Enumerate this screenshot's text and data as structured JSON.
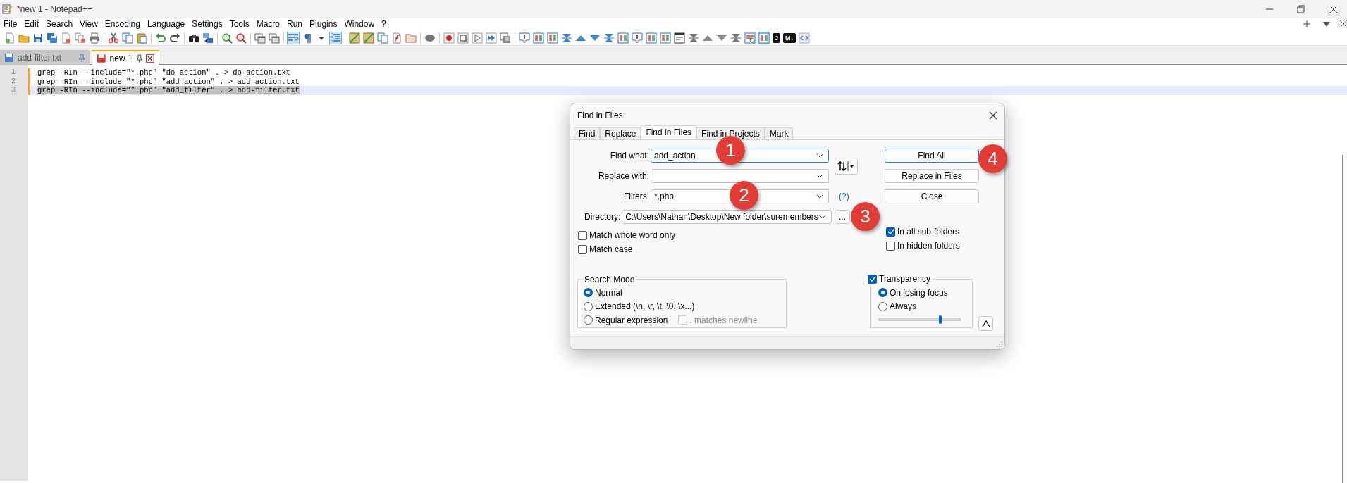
{
  "window": {
    "title": "*new 1 - Notepad++"
  },
  "menu": [
    "File",
    "Edit",
    "Search",
    "View",
    "Encoding",
    "Language",
    "Settings",
    "Tools",
    "Macro",
    "Run",
    "Plugins",
    "Window",
    "?"
  ],
  "toolbar_toggles": [
    {
      "pressed": true
    },
    {
      "pressed": false
    },
    {
      "pressed": true
    },
    {
      "pressed": true
    }
  ],
  "toolbar_badges": [
    "J",
    "M↓"
  ],
  "tabs": [
    {
      "label": "add-filter.txt",
      "selected": false
    },
    {
      "label": "new 1",
      "selected": true
    }
  ],
  "editor": {
    "lines": [
      {
        "number": "1",
        "text": "grep -RIn --include=\"*.php\" \"do_action\" . > do-action.txt",
        "selected": false
      },
      {
        "number": "2",
        "text": "grep -RIn --include=\"*.php\" \"add_action\" . > add-action.txt",
        "selected": false
      },
      {
        "number": "3",
        "text": "grep -RIn --include=\"*.php\" \"add_filter\" . > add-filter.txt",
        "selected": true
      }
    ]
  },
  "dialog": {
    "title": "Find in Files",
    "tabs": [
      {
        "label": "Find",
        "selected": false
      },
      {
        "label": "Replace",
        "selected": false
      },
      {
        "label": "Find in Files",
        "selected": true
      },
      {
        "label": "Find in Projects",
        "selected": false
      },
      {
        "label": "Mark",
        "selected": false
      }
    ],
    "fields": [
      {
        "kind": "combo",
        "label": "Find what:",
        "value": "add_action",
        "focused": true
      },
      {
        "kind": "combo",
        "label": "Replace with:",
        "focused": false
      },
      {
        "kind": "combo",
        "label": "Filters:",
        "value": "*.php",
        "focused": false,
        "help": "(?)"
      },
      {
        "kind": "folder",
        "label": "Directory:",
        "value": "C:\\Users\\Nathan\\Desktop\\New folder\\suremembers",
        "focused": false,
        "browse": "..."
      }
    ],
    "buttons": [
      {
        "label": "Find All",
        "default": true
      },
      {
        "label": "Replace in Files",
        "default": false
      },
      {
        "label": "Close",
        "default": false
      }
    ],
    "options": [
      {
        "label": "Match whole word only",
        "checked": false
      },
      {
        "label": "Match case",
        "checked": false
      }
    ],
    "folder_options": [
      {
        "label": "In all sub-folders",
        "checked": true
      },
      {
        "label": "In hidden folders",
        "checked": false
      }
    ],
    "search_mode": {
      "title": "Search Mode",
      "options": [
        {
          "label": "Normal",
          "selected": true
        },
        {
          "label": "Extended (\\n, \\r, \\t, \\0, \\x...)",
          "selected": false
        },
        {
          "label": "Regular expression",
          "selected": false
        }
      ],
      "dot_newline": {
        "label": ". matches newline",
        "checked": false,
        "disabled": true
      }
    },
    "transparency": {
      "label": "Transparency",
      "checked": true,
      "options": [
        {
          "label": "On losing focus",
          "selected": true
        },
        {
          "label": "Always",
          "selected": false
        }
      ],
      "level": 0.76
    }
  },
  "annotations": [
    {
      "label": "1"
    },
    {
      "label": "2"
    },
    {
      "label": "3"
    },
    {
      "label": "4"
    }
  ]
}
